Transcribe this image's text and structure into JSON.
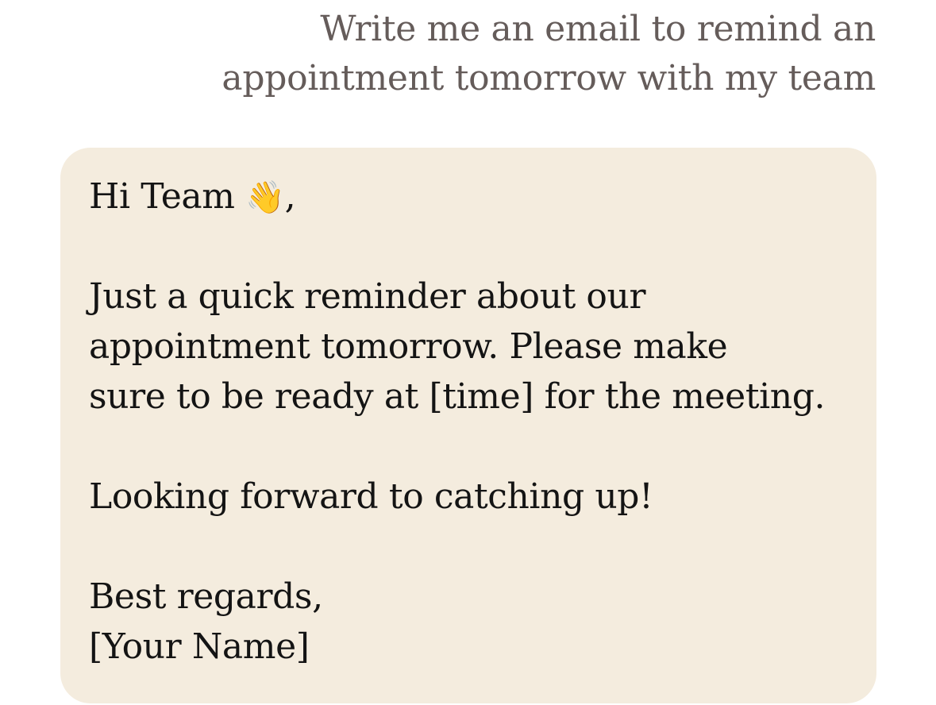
{
  "user_message": {
    "lines": [
      "Write me an email to remind an",
      "appointment tomorrow with my team"
    ]
  },
  "assistant_reply": {
    "greeting": "Hi Team",
    "greeting_emoji": "👋",
    "greeting_suffix": ",",
    "body_lines": [
      "Just a quick reminder about our",
      "appointment tomorrow. Please make",
      "sure to be ready at [time] for the meeting."
    ],
    "closing_line": "Looking forward to catching up!",
    "signoff": "Best regards,",
    "signature": "[Your Name]"
  },
  "colors": {
    "bubble_background": "#f4ecde",
    "user_text": "#655c5a",
    "reply_text": "#141414"
  },
  "icons": {
    "greeting_emoji": "waving-hand-icon"
  }
}
